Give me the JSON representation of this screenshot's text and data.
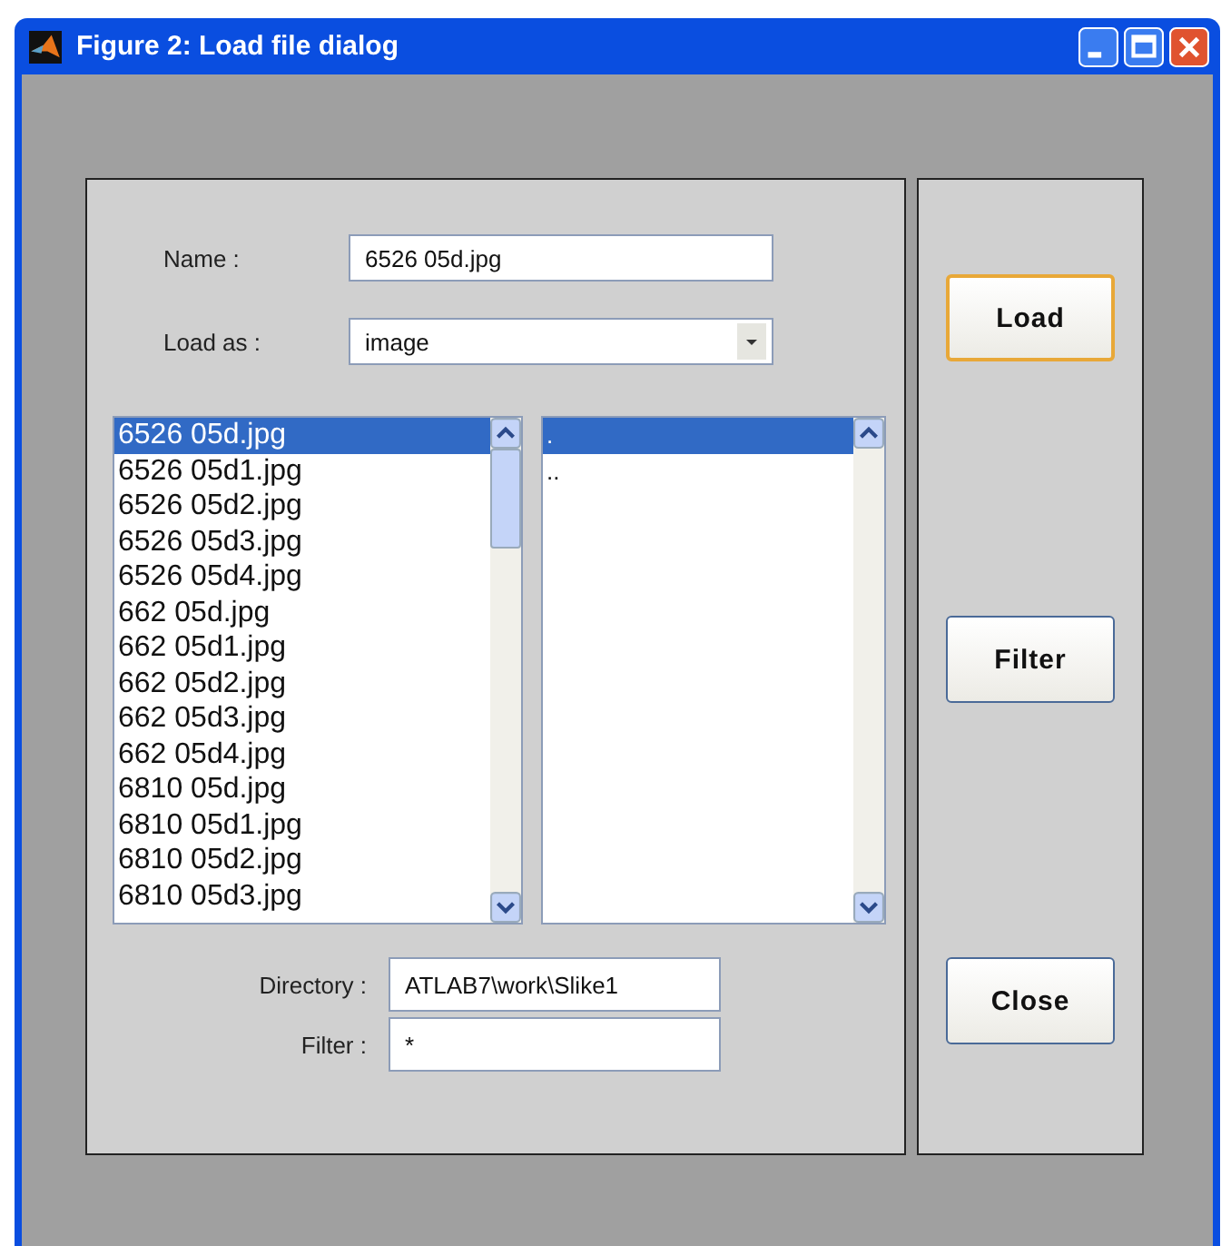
{
  "window": {
    "title": "Figure 2: Load file dialog"
  },
  "name_field": {
    "label": "Name :",
    "value": "6526 05d.jpg"
  },
  "load_as": {
    "label": "Load as :",
    "value": "image"
  },
  "files": [
    {
      "name": "6526 05d.jpg",
      "selected": true
    },
    {
      "name": "6526 05d1.jpg",
      "selected": false
    },
    {
      "name": "6526 05d2.jpg",
      "selected": false
    },
    {
      "name": "6526 05d3.jpg",
      "selected": false
    },
    {
      "name": "6526 05d4.jpg",
      "selected": false
    },
    {
      "name": "662 05d.jpg",
      "selected": false
    },
    {
      "name": "662 05d1.jpg",
      "selected": false
    },
    {
      "name": "662 05d2.jpg",
      "selected": false
    },
    {
      "name": "662 05d3.jpg",
      "selected": false
    },
    {
      "name": "662 05d4.jpg",
      "selected": false
    },
    {
      "name": "6810 05d.jpg",
      "selected": false
    },
    {
      "name": "6810 05d1.jpg",
      "selected": false
    },
    {
      "name": "6810 05d2.jpg",
      "selected": false
    },
    {
      "name": "6810 05d3.jpg",
      "selected": false
    }
  ],
  "folders": [
    {
      "name": ".",
      "selected": true
    },
    {
      "name": "..",
      "selected": false
    }
  ],
  "directory": {
    "label": "Directory :",
    "value": "ATLAB7\\work\\Slike1"
  },
  "filter": {
    "label": "Filter :",
    "value": "*"
  },
  "buttons": [
    {
      "label": "Load",
      "focused": true
    },
    {
      "label": "Filter",
      "focused": false
    },
    {
      "label": "Close",
      "focused": false
    }
  ]
}
